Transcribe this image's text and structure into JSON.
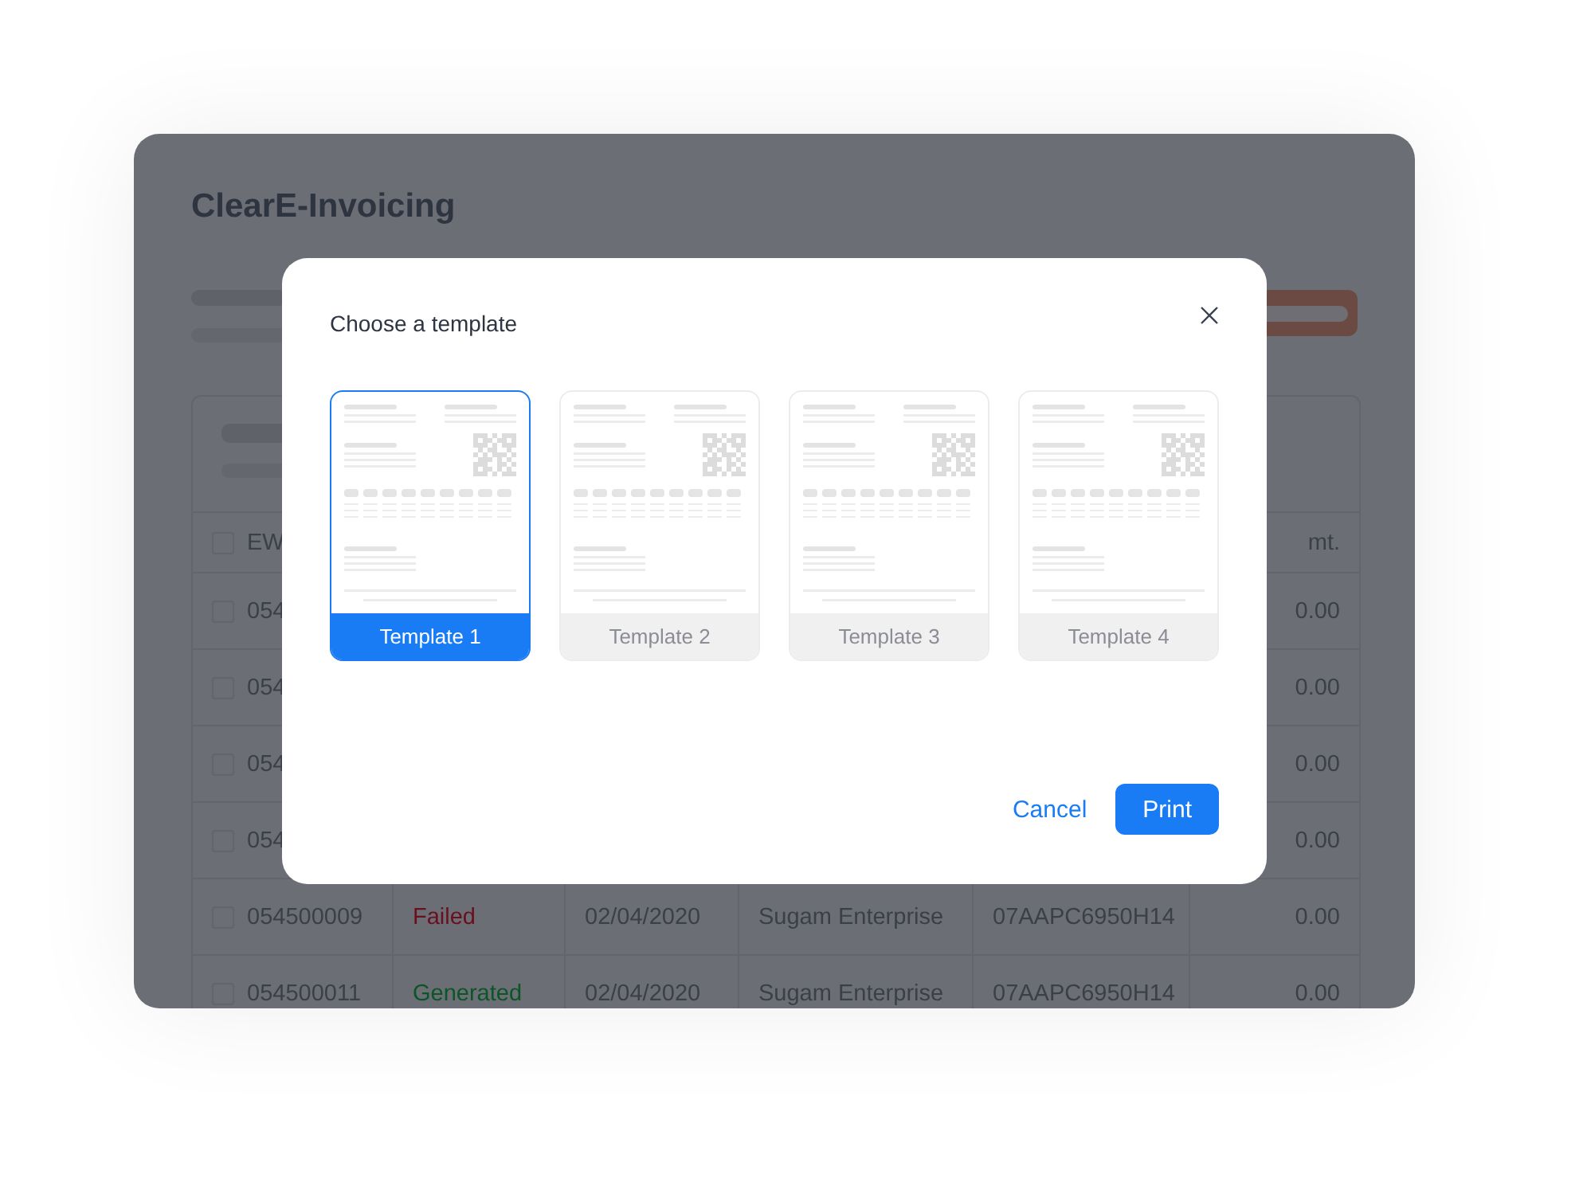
{
  "app": {
    "title": "ClearE-Invoicing"
  },
  "table": {
    "header": {
      "checked": false,
      "first": "EW",
      "last": "mt."
    },
    "rows": [
      {
        "checked": false,
        "id": "054",
        "amount": "0.00"
      },
      {
        "checked": false,
        "id": "054",
        "amount": "0.00"
      },
      {
        "checked": false,
        "id": "054",
        "amount": "0.00"
      },
      {
        "checked": false,
        "id": "054",
        "amount": "0.00"
      },
      {
        "checked": false,
        "id": "054500009",
        "status": {
          "text": "Failed",
          "color": "#6a0f1e"
        },
        "date": "02/04/2020",
        "party": "Sugam Enterprise",
        "gstin": "07AAPC6950H14",
        "amount": "0.00"
      },
      {
        "checked": false,
        "id": "054500011",
        "status": {
          "text": "Generated",
          "color": "#0c5527"
        },
        "date": "02/04/2020",
        "party": "Sugam Enterprise",
        "gstin": "07AAPC6950H14",
        "amount": "0.00"
      }
    ]
  },
  "dialog": {
    "title": "Choose a template",
    "templates": [
      {
        "label": "Template 1",
        "selected": true
      },
      {
        "label": "Template 2",
        "selected": false
      },
      {
        "label": "Template 3",
        "selected": false
      },
      {
        "label": "Template 4",
        "selected": false
      }
    ],
    "buttons": [
      {
        "kind": "secondary",
        "label": "Cancel"
      },
      {
        "kind": "primary",
        "label": "Print"
      }
    ]
  }
}
